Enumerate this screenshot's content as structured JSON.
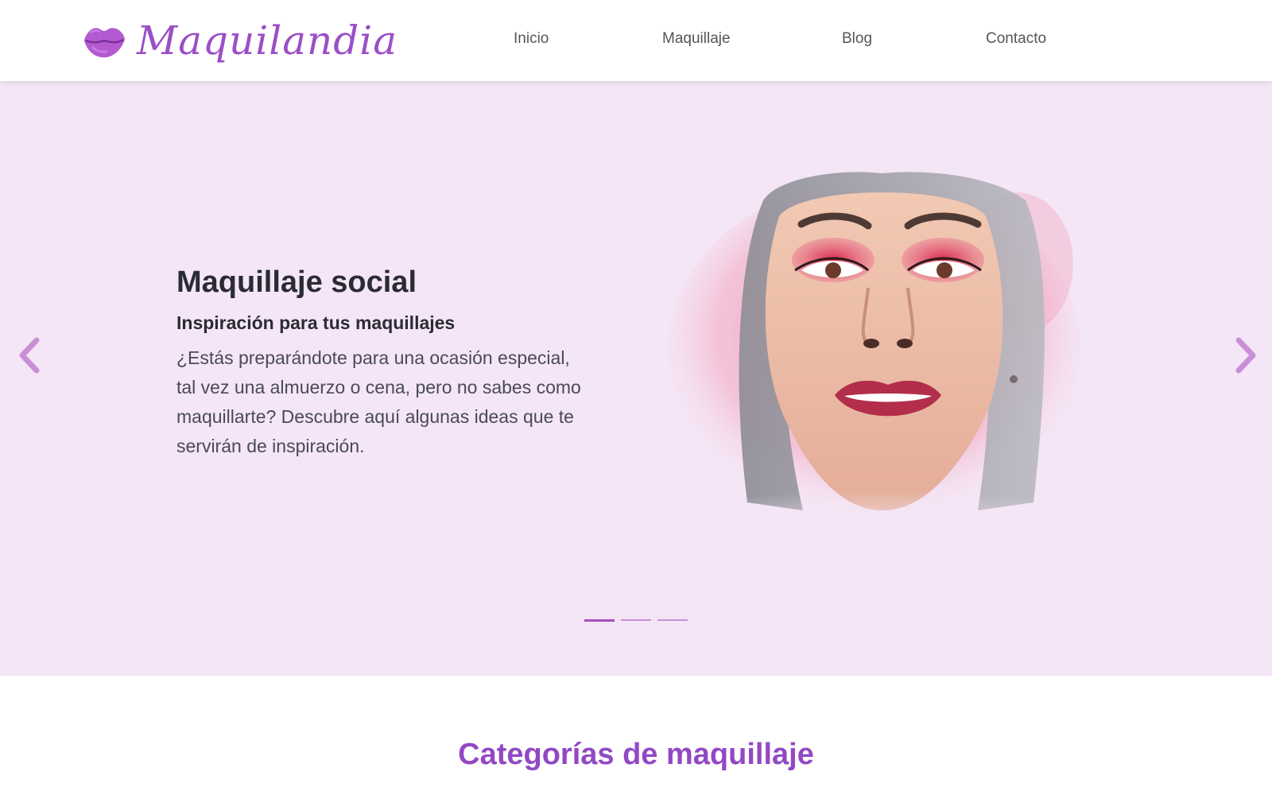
{
  "brand": {
    "name": "Maquilandia",
    "logo_icon": "lips-icon",
    "color": "#9b4fc7"
  },
  "nav": {
    "items": [
      {
        "label": "Inicio"
      },
      {
        "label": "Maquillaje"
      },
      {
        "label": "Blog"
      },
      {
        "label": "Contacto"
      }
    ]
  },
  "hero": {
    "title": "Maquillaje social",
    "subtitle": "Inspiración para tus maquillajes",
    "body": "¿Estás preparándote para una ocasión especial, tal vez una almuerzo o cena, pero no sabes como maquillarte? Descubre aquí algunas ideas que te servirán de inspiración.",
    "background": "#f4e6f6",
    "prev_icon": "chevron-left-icon",
    "next_icon": "chevron-right-icon",
    "slides_total": 3,
    "active_slide": 1
  },
  "categories": {
    "title": "Categorías de maquillaje",
    "color": "#9248c4"
  }
}
